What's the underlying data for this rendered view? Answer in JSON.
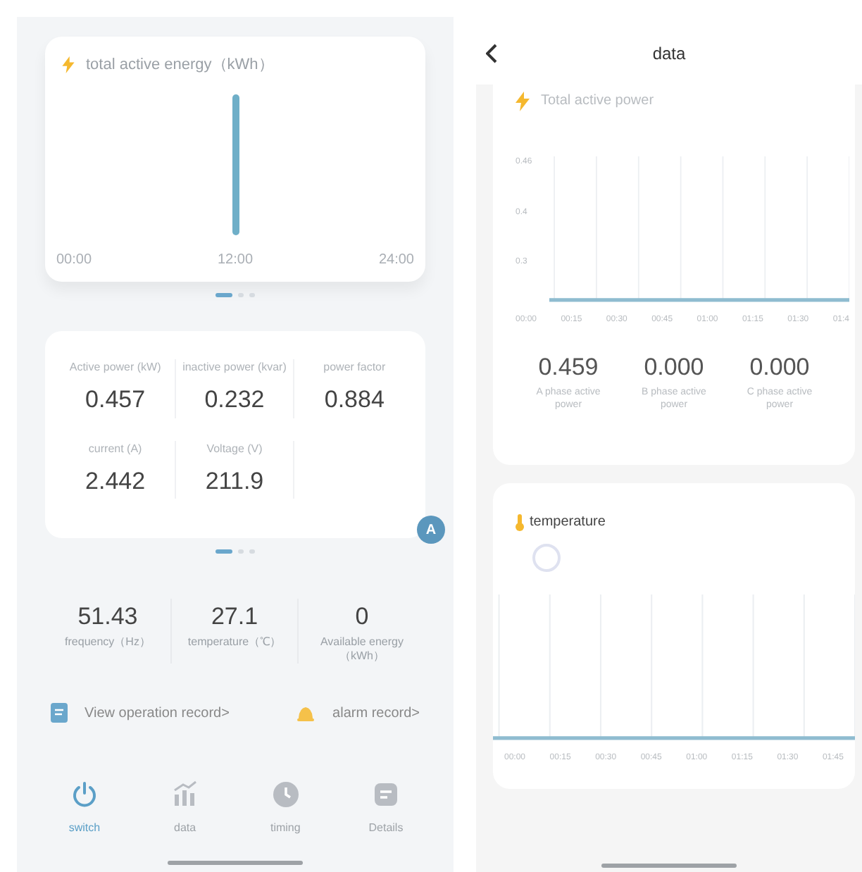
{
  "switch_page": {
    "energy_card": {
      "title": "total active energy（kWh）",
      "x_labels": [
        "00:00",
        "12:00",
        "24:00"
      ]
    },
    "metrics": [
      {
        "label": "Active power (kW)",
        "value": "0.457"
      },
      {
        "label": "inactive power (kvar)",
        "value": "0.232"
      },
      {
        "label": "power factor",
        "value": "0.884"
      },
      {
        "label": "current (A)",
        "value": "2.442"
      },
      {
        "label": "Voltage (V)",
        "value": "211.9"
      }
    ],
    "badge": "A",
    "stats": [
      {
        "value": "51.43",
        "label": "frequency（Hz）"
      },
      {
        "value": "27.1",
        "label": "temperature（℃）"
      },
      {
        "value": "0",
        "label": "Available energy（kWh）"
      }
    ],
    "links": [
      {
        "kind": "log",
        "label": "View operation record>"
      },
      {
        "kind": "alarm",
        "label": "alarm record>"
      }
    ],
    "tabs": [
      {
        "kind": "power",
        "label": "switch",
        "selected": true
      },
      {
        "kind": "chart",
        "label": "data",
        "selected": false
      },
      {
        "kind": "clock",
        "label": "timing",
        "selected": false
      },
      {
        "kind": "doc",
        "label": "Details",
        "selected": false
      }
    ]
  },
  "data_page": {
    "title": "data",
    "power_card": {
      "title": "Total active power",
      "y_labels": [
        "0.46",
        "0.4",
        "0.3"
      ],
      "x_labels": [
        "00:00",
        "00:15",
        "00:30",
        "00:45",
        "01:00",
        "01:15",
        "01:30",
        "01:4"
      ],
      "phases": [
        {
          "value": "0.459",
          "label": "A phase active power"
        },
        {
          "value": "0.000",
          "label": "B phase active power"
        },
        {
          "value": "0.000",
          "label": "C phase active power"
        }
      ]
    },
    "temperature_card": {
      "title": "temperature",
      "loading": true,
      "x_labels": [
        "00:00",
        "00:15",
        "00:30",
        "00:45",
        "01:00",
        "01:15",
        "01:30",
        "01:45"
      ]
    }
  }
}
